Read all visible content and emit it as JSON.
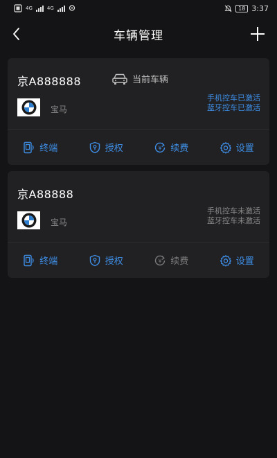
{
  "status_bar": {
    "net1": "4G",
    "net2": "4G",
    "battery": "18",
    "time": "3:37"
  },
  "nav": {
    "title": "车辆管理",
    "back_icon": "chevron-left-icon",
    "add_icon": "plus-icon"
  },
  "vehicles": [
    {
      "plate": "京A888888",
      "current_label": "当前车辆",
      "brand": "宝马",
      "phone_control": "手机控车已激活",
      "bt_control": "蓝牙控车已激活",
      "actions": [
        {
          "label": "终端",
          "icon": "terminal-device-icon"
        },
        {
          "label": "授权",
          "icon": "shield-key-icon"
        },
        {
          "label": "续费",
          "icon": "renew-yen-icon"
        },
        {
          "label": "设置",
          "icon": "gear-icon"
        }
      ]
    },
    {
      "plate": "京A88888",
      "brand": "宝马",
      "phone_control": "手机控车未激活",
      "bt_control": "蓝牙控车未激活",
      "actions": [
        {
          "label": "终端",
          "icon": "terminal-device-icon"
        },
        {
          "label": "授权",
          "icon": "shield-key-icon"
        },
        {
          "label": "续费",
          "icon": "renew-yen-icon"
        },
        {
          "label": "设置",
          "icon": "gear-icon"
        }
      ]
    }
  ],
  "colors": {
    "background": "#141416",
    "card": "#212124",
    "accent": "#3e8ee6",
    "muted": "#8a8a8a"
  }
}
